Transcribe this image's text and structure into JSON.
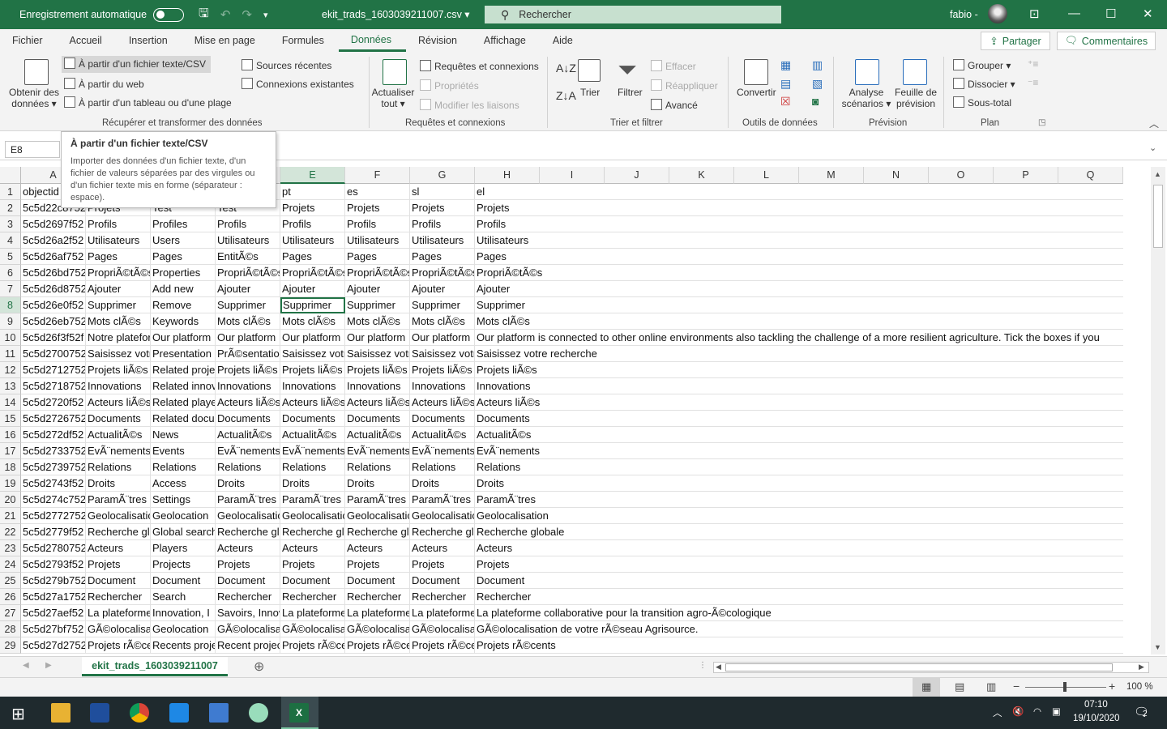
{
  "titlebar": {
    "autosave": "Enregistrement automatique",
    "filename": "ekit_trads_1603039211007.csv",
    "search": "Rechercher",
    "user": "fabio"
  },
  "menu": [
    "Fichier",
    "Accueil",
    "Insertion",
    "Mise en page",
    "Formules",
    "Données",
    "Révision",
    "Affichage",
    "Aide"
  ],
  "share": "Partager",
  "comments": "Commentaires",
  "ribbon": {
    "obtenir1": "Obtenir des",
    "obtenir2": "données",
    "fichier_texte": "À partir d'un fichier texte/CSV",
    "web": "À partir du web",
    "tableau": "À partir d'un tableau ou d'une plage",
    "sources": "Sources récentes",
    "connexions": "Connexions existantes",
    "grp1": "Récupérer et transformer des données",
    "actualiser1": "Actualiser",
    "actualiser2": "tout",
    "req_conn": "Requêtes et connexions",
    "proprietes": "Propriétés",
    "modifier": "Modifier les liaisons",
    "grp2": "Requêtes et connexions",
    "trier": "Trier",
    "filtrer": "Filtrer",
    "effacer": "Effacer",
    "reappliquer": "Réappliquer",
    "avance": "Avancé",
    "grp3": "Trier et filtrer",
    "convertir": "Convertir",
    "grp4": "Outils de données",
    "analyse1": "Analyse",
    "analyse2": "scénarios",
    "feuille1": "Feuille de",
    "feuille2": "prévision",
    "grp5": "Prévision",
    "grouper": "Grouper",
    "dissocier": "Dissocier",
    "soustotal": "Sous-total",
    "grp6": "Plan"
  },
  "namebox": "E8",
  "tooltip": {
    "title": "À partir d'un fichier texte/CSV",
    "body": "Importer des données d'un fichier texte, d'un fichier de valeurs séparées par des virgules ou d'un fichier texte mis en forme (séparateur : espace)."
  },
  "columns": [
    "A",
    "B",
    "C",
    "D",
    "E",
    "F",
    "G",
    "H",
    "I",
    "J",
    "K",
    "L",
    "M",
    "N",
    "O",
    "P",
    "Q"
  ],
  "rows": [
    [
      "objectid",
      "",
      "",
      "",
      "pt",
      "es",
      "sl",
      "el"
    ],
    [
      "5c5d22c8752",
      "Projets",
      "Test",
      "Test",
      "Projets",
      "Projets",
      "Projets",
      "Projets"
    ],
    [
      "5c5d2697f52",
      "Profils",
      "Profiles",
      "Profils",
      "Profils",
      "Profils",
      "Profils",
      "Profils"
    ],
    [
      "5c5d26a2f52",
      "Utilisateurs",
      "Users",
      "Utilisateurs",
      "Utilisateurs",
      "Utilisateurs",
      "Utilisateurs",
      "Utilisateurs"
    ],
    [
      "5c5d26af752",
      "Pages",
      "Pages",
      "EntitÃ©s",
      "Pages",
      "Pages",
      "Pages",
      "Pages"
    ],
    [
      "5c5d26bd752",
      "PropriÃ©tÃ©s",
      "Properties",
      "PropriÃ©tÃ©s",
      "PropriÃ©tÃ©s",
      "PropriÃ©tÃ©s",
      "PropriÃ©tÃ©s",
      "PropriÃ©tÃ©s"
    ],
    [
      "5c5d26d8752",
      "Ajouter",
      "Add new",
      "Ajouter",
      "Ajouter",
      "Ajouter",
      "Ajouter",
      "Ajouter"
    ],
    [
      "5c5d26e0f52",
      "Supprimer",
      "Remove",
      "Supprimer",
      "Supprimer",
      "Supprimer",
      "Supprimer",
      "Supprimer"
    ],
    [
      "5c5d26eb752",
      "Mots clÃ©s",
      "Keywords",
      "Mots clÃ©s",
      "Mots clÃ©s",
      "Mots clÃ©s",
      "Mots clÃ©s",
      "Mots clÃ©s"
    ],
    [
      "5c5d26f3f52f",
      "Notre plateforme",
      "Our platform",
      "Our platform",
      "Our platform",
      "Our platform",
      "Our platform",
      "Our platform is connected to other online environments also tackling the challenge of a more resilient agriculture. Tick the boxes if you"
    ],
    [
      "5c5d2700752",
      "Saisissez votre",
      "Presentation",
      "PrÃ©sentation",
      "Saisissez votre",
      "Saisissez votre",
      "Saisissez votre",
      "Saisissez votre recherche"
    ],
    [
      "5c5d2712752",
      "Projets liÃ©s",
      "Related projects",
      "Projets liÃ©s",
      "Projets liÃ©s",
      "Projets liÃ©s",
      "Projets liÃ©s",
      "Projets liÃ©s"
    ],
    [
      "5c5d2718752",
      "Innovations",
      "Related innovations",
      "Innovations",
      "Innovations",
      "Innovations",
      "Innovations",
      "Innovations"
    ],
    [
      "5c5d2720f52",
      "Acteurs liÃ©s",
      "Related players",
      "Acteurs liÃ©s",
      "Acteurs liÃ©s",
      "Acteurs liÃ©s",
      "Acteurs liÃ©s",
      "Acteurs liÃ©s"
    ],
    [
      "5c5d2726752",
      "Documents",
      "Related documents",
      "Documents",
      "Documents",
      "Documents",
      "Documents",
      "Documents"
    ],
    [
      "5c5d272df52",
      "ActualitÃ©s",
      "News",
      "ActualitÃ©s",
      "ActualitÃ©s",
      "ActualitÃ©s",
      "ActualitÃ©s",
      "ActualitÃ©s"
    ],
    [
      "5c5d2733752",
      "EvÃ¨nements",
      "Events",
      "EvÃ¨nements",
      "EvÃ¨nements",
      "EvÃ¨nements",
      "EvÃ¨nements",
      "EvÃ¨nements"
    ],
    [
      "5c5d2739752",
      "Relations",
      "Relations",
      "Relations",
      "Relations",
      "Relations",
      "Relations",
      "Relations"
    ],
    [
      "5c5d2743f52",
      "Droits",
      "Access",
      "Droits",
      "Droits",
      "Droits",
      "Droits",
      "Droits"
    ],
    [
      "5c5d274c752",
      "ParamÃ¨tres",
      "Settings",
      "ParamÃ¨tres",
      "ParamÃ¨tres",
      "ParamÃ¨tres",
      "ParamÃ¨tres",
      "ParamÃ¨tres"
    ],
    [
      "5c5d2772752",
      "Geolocalisation",
      "Geolocation",
      "Geolocalisation",
      "Geolocalisation",
      "Geolocalisation",
      "Geolocalisation",
      "Geolocalisation"
    ],
    [
      "5c5d2779f52",
      "Recherche globale",
      "Global search",
      "Recherche globale",
      "Recherche globale",
      "Recherche globale",
      "Recherche globale",
      "Recherche globale"
    ],
    [
      "5c5d2780752",
      "Acteurs",
      "Players",
      "Acteurs",
      "Acteurs",
      "Acteurs",
      "Acteurs",
      "Acteurs"
    ],
    [
      "5c5d2793f52",
      "Projets",
      "Projects",
      "Projets",
      "Projets",
      "Projets",
      "Projets",
      "Projets"
    ],
    [
      "5c5d279b752",
      "Document",
      "Document",
      "Document",
      "Document",
      "Document",
      "Document",
      "Document"
    ],
    [
      "5c5d27a1752",
      "Rechercher",
      "Search",
      "Rechercher",
      "Rechercher",
      "Rechercher",
      "Rechercher",
      "Rechercher"
    ],
    [
      "5c5d27aef52",
      "La plateforme",
      "Innovation, I",
      "Savoirs, Innovations",
      "La plateforme",
      "La plateforme",
      "La plateforme",
      "La plateforme collaborative pour la transition agro-Ã©cologique"
    ],
    [
      "5c5d27bf752",
      "GÃ©olocalisation",
      "Geolocation",
      "GÃ©olocalisation",
      "GÃ©olocalisation",
      "GÃ©olocalisation",
      "GÃ©olocalisation",
      "GÃ©olocalisation de votre rÃ©seau Agrisource."
    ],
    [
      "5c5d27d2752",
      "Projets rÃ©cents",
      "Recents projects",
      "Recent projects",
      "Projets rÃ©cents",
      "Projets rÃ©cents",
      "Projets rÃ©cents",
      "Projets rÃ©cents"
    ]
  ],
  "sheet_tab": "ekit_trads_1603039211007",
  "zoom": "100 %",
  "clock": {
    "time": "07:10",
    "date": "19/10/2020"
  },
  "notif_count": "2",
  "colors": {
    "excel_green": "#217346"
  }
}
